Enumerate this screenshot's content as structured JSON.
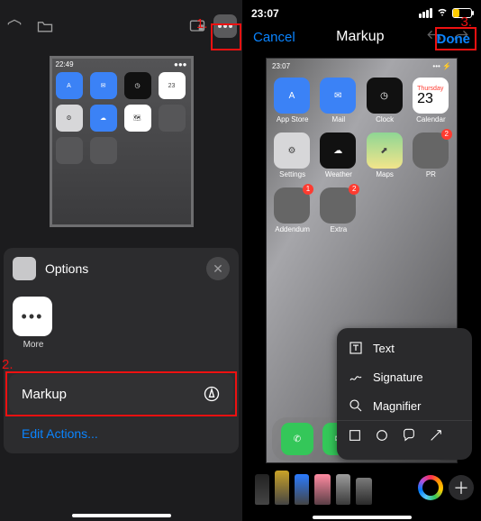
{
  "left": {
    "thumb_time": "22:49",
    "sheet_title": "Options",
    "more_label": "More",
    "markup_label": "Markup",
    "edit_actions": "Edit Actions...",
    "callouts": {
      "one": "1.",
      "two": "2."
    }
  },
  "right": {
    "status_time": "23:07",
    "nav_cancel": "Cancel",
    "nav_title": "Markup",
    "nav_done": "Done",
    "canvas_time": "23:07",
    "canvas_day": "Thursday",
    "canvas_date": "23",
    "apps": {
      "appstore": "App Store",
      "mail": "Mail",
      "clock": "Clock",
      "calendar": "Calendar",
      "settings": "Settings",
      "weather": "Weather",
      "maps": "Maps",
      "pr": "PR",
      "addendum": "Addendum",
      "extra": "Extra"
    },
    "badges": {
      "pr": "2",
      "addendum": "1",
      "extra": "2"
    },
    "popup": {
      "text": "Text",
      "signature": "Signature",
      "magnifier": "Magnifier"
    },
    "callouts": {
      "three": "3."
    }
  }
}
